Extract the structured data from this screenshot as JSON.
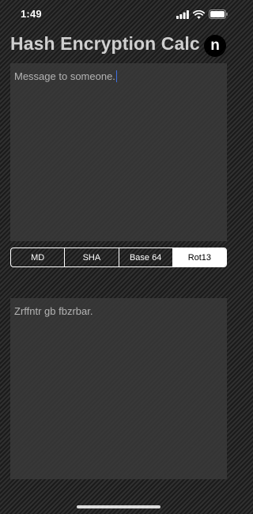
{
  "status_bar": {
    "time": "1:49",
    "icons": [
      "signal-icon",
      "wifi-icon",
      "battery-icon"
    ]
  },
  "header": {
    "title": "Hash Encryption Calc",
    "logo_letter": "n"
  },
  "input": {
    "text": "Message to someone."
  },
  "segments": {
    "items": [
      {
        "label": "MD",
        "selected": false
      },
      {
        "label": "SHA",
        "selected": false
      },
      {
        "label": "Base 64",
        "selected": false
      },
      {
        "label": "Rot13",
        "selected": true
      }
    ]
  },
  "output": {
    "text": "Zrffntr gb fbzrbar."
  },
  "colors": {
    "caret": "#3f6fe0",
    "selected_segment_bg": "#ffffff",
    "title": "#cfcfcf"
  }
}
